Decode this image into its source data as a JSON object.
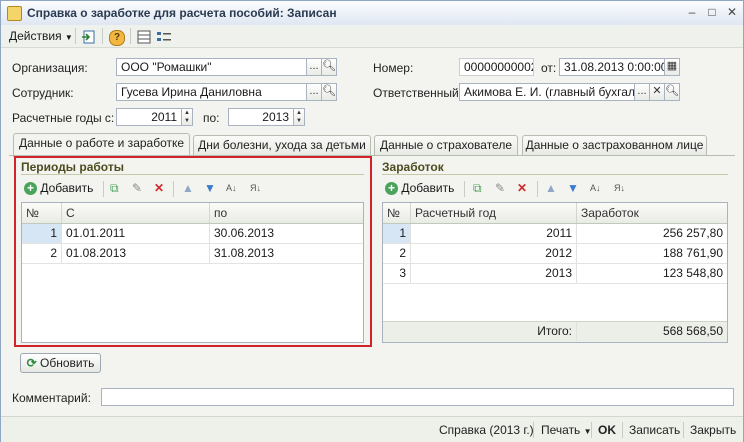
{
  "window": {
    "title": "Справка о заработке для расчета пособий: Записан",
    "minimize": "–",
    "maximize": "□",
    "close": "✕"
  },
  "toolbar": {
    "actions_label": "Действия",
    "help_label": "?"
  },
  "header": {
    "org_label": "Организация:",
    "org_value": "ООО \"Ромашки\"",
    "emp_label": "Сотрудник:",
    "emp_value": "Гусева Ирина Даниловна",
    "years_label": "Расчетные годы с:",
    "year_from": "2011",
    "to_label": "по:",
    "year_to": "2013",
    "number_label": "Номер:",
    "number_value": "00000000002",
    "from_label": "от:",
    "date_value": "31.08.2013  0:00:00",
    "resp_label": "Ответственный:",
    "resp_value": "Акимова Е. И. (главный бухгалтер)",
    "ellipsis": "...",
    "spin_up": "▲",
    "spin_down": "▼"
  },
  "tabs": [
    {
      "label": "Данные о работе и заработке"
    },
    {
      "label": "Дни болезни, ухода за детьми"
    },
    {
      "label": "Данные о страхователе"
    },
    {
      "label": "Данные о застрахованном лице"
    }
  ],
  "periods": {
    "title": "Периоды работы",
    "add_label": "Добавить",
    "columns": [
      "№",
      "С",
      "по"
    ],
    "rows": [
      {
        "n": "1",
        "from": "01.01.2011",
        "to": "30.06.2013"
      },
      {
        "n": "2",
        "from": "01.08.2013",
        "to": "31.08.2013"
      }
    ]
  },
  "earnings": {
    "title": "Заработок",
    "add_label": "Добавить",
    "columns": [
      "№",
      "Расчетный год",
      "Заработок"
    ],
    "rows": [
      {
        "n": "1",
        "year": "2011",
        "amount": "256 257,80"
      },
      {
        "n": "2",
        "year": "2012",
        "amount": "188 761,90"
      },
      {
        "n": "3",
        "year": "2013",
        "amount": "123 548,80"
      }
    ],
    "total_label": "Итого:",
    "total_value": "568 568,50"
  },
  "refresh_label": "Обновить",
  "comment_label": "Комментарий:",
  "comment_value": "",
  "bottom": {
    "ref_label": "Справка (2013 г.)",
    "print_label": "Печать",
    "ok_label": "OK",
    "save_label": "Записать",
    "close_label": "Закрыть"
  },
  "colors": {
    "highlight_border": "#d1232a",
    "selected_row": "#d7e6f5",
    "group_title": "#4d4b1f"
  }
}
